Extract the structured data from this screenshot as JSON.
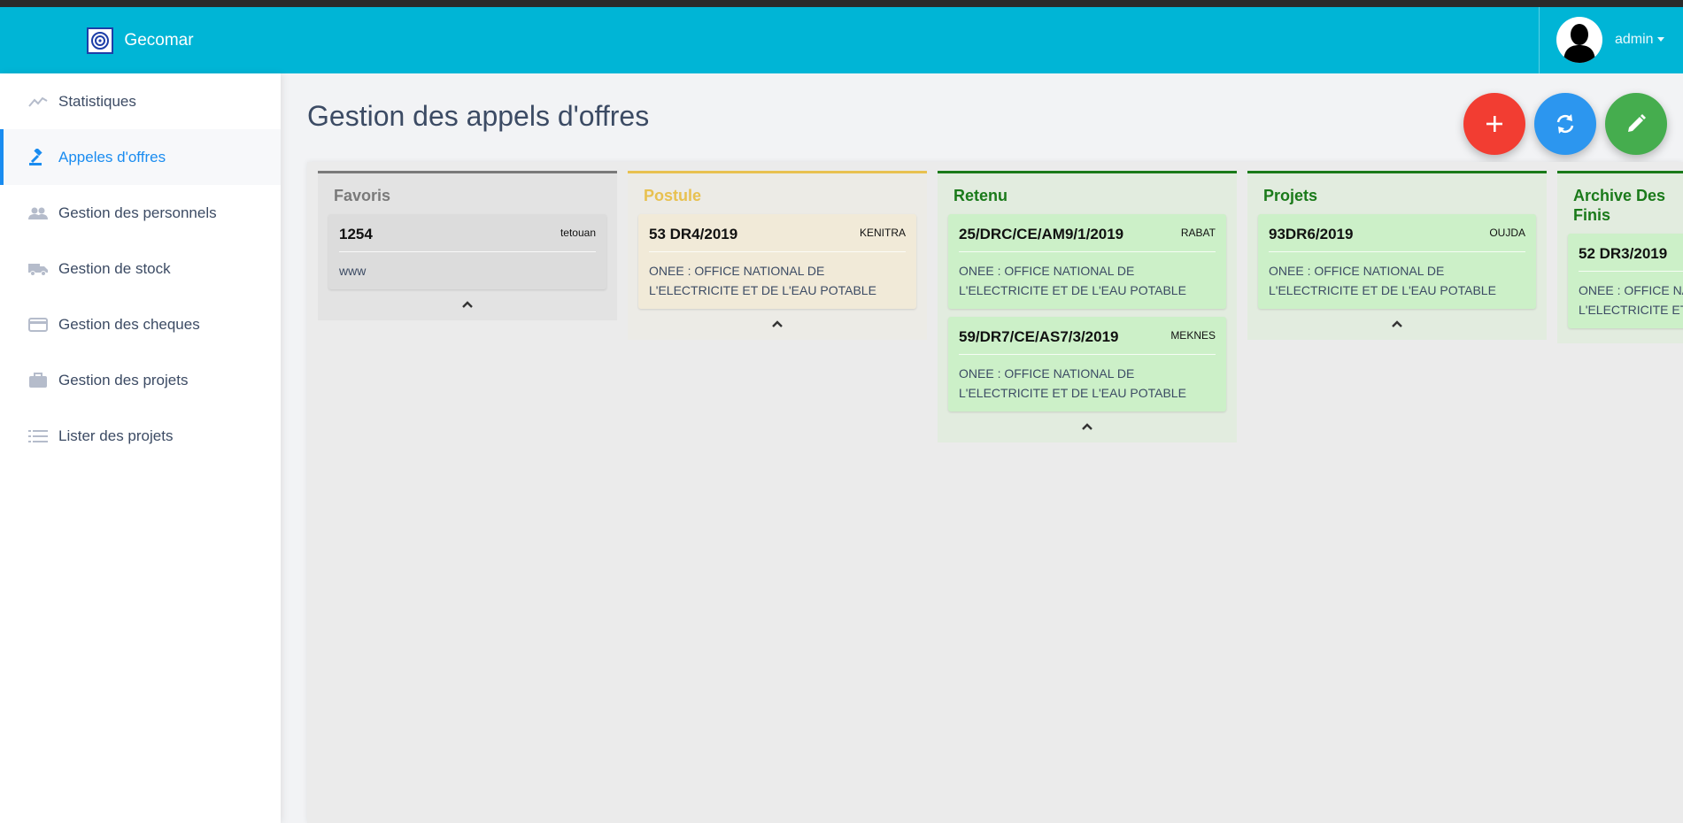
{
  "app": {
    "name": "Gecomar"
  },
  "user": {
    "name": "admin"
  },
  "sidebar": {
    "items": [
      {
        "label": "Statistiques",
        "icon": "chart-line-icon"
      },
      {
        "label": "Appeles d'offres",
        "icon": "gavel-icon",
        "active": true
      },
      {
        "label": "Gestion des personnels",
        "icon": "users-icon"
      },
      {
        "label": "Gestion de stock",
        "icon": "truck-icon"
      },
      {
        "label": "Gestion des cheques",
        "icon": "credit-card-icon"
      },
      {
        "label": "Gestion des projets",
        "icon": "briefcase-icon"
      },
      {
        "label": "Lister des projets",
        "icon": "list-icon"
      }
    ]
  },
  "page": {
    "title": "Gestion des appels d'offres",
    "actions": [
      {
        "icon": "plus-icon",
        "color": "#f23d32"
      },
      {
        "icon": "refresh-icon",
        "color": "#2c96ef"
      },
      {
        "icon": "pencil-icon",
        "color": "#45ad4e"
      }
    ]
  },
  "board": {
    "columns": [
      {
        "title": "Favoris",
        "color": "#7a7a7a",
        "cards": [
          {
            "ref": "1254",
            "city": "tetouan",
            "desc": "www"
          }
        ]
      },
      {
        "title": "Postule",
        "color": "#e8c150",
        "cards": [
          {
            "ref": "53 DR4/2019",
            "city": "KENITRA",
            "desc": "ONEE : OFFICE NATIONAL DE L'ELECTRICITE ET DE L'EAU POTABLE"
          }
        ]
      },
      {
        "title": "Retenu",
        "color": "#1a7a1a",
        "cards": [
          {
            "ref": "25/DRC/CE/AM9/1/2019",
            "city": "RABAT",
            "desc": "ONEE : OFFICE NATIONAL DE L'ELECTRICITE ET DE L'EAU POTABLE"
          },
          {
            "ref": "59/DR7/CE/AS7/3/2019",
            "city": "MEKNES",
            "desc": "ONEE : OFFICE NATIONAL DE L'ELECTRICITE ET DE L'EAU POTABLE"
          }
        ]
      },
      {
        "title": "Projets",
        "color": "#1a7a1a",
        "cards": [
          {
            "ref": "93DR6/2019",
            "city": "OUJDA",
            "desc": "ONEE : OFFICE NATIONAL DE L'ELECTRICITE ET DE L'EAU POTABLE"
          }
        ]
      },
      {
        "title": "Archive Des Finis",
        "color": "#1a7a1a",
        "cards": [
          {
            "ref": "52 DR3/2019",
            "city": "",
            "desc": "ONEE : OFFICE NATIONAL DE L'ELECTRICITE ET DE L'EAU POTABLE"
          }
        ]
      }
    ]
  }
}
